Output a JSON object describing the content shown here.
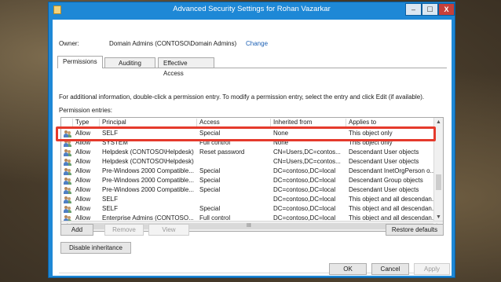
{
  "window": {
    "title": "Advanced Security Settings for Rohan Vazarkar",
    "min": "–",
    "max": "☐",
    "close": "X"
  },
  "owner": {
    "label": "Owner:",
    "value": "Domain Admins (CONTOSO\\Domain Admins)",
    "change_link": "Change"
  },
  "tabs": [
    {
      "label": "Permissions",
      "active": true
    },
    {
      "label": "Auditing"
    },
    {
      "label": "Effective Access"
    }
  ],
  "info_text": "For additional information, double-click a permission entry. To modify a permission entry, select the entry and click Edit (if available).",
  "permission_entries_label": "Permission entries:",
  "columns": [
    "Type",
    "Principal",
    "Access",
    "Inherited from",
    "Applies to"
  ],
  "rows": [
    {
      "type": "Allow",
      "principal": "SELF",
      "access": "Special",
      "inherited": "None",
      "applies": "This object only"
    },
    {
      "type": "Allow",
      "principal": "SYSTEM",
      "access": "Full control",
      "inherited": "None",
      "applies": "This object only"
    },
    {
      "type": "Allow",
      "principal": "Helpdesk (CONTOSO\\Helpdesk)",
      "access": "Reset password",
      "inherited": "CN=Users,DC=contos...",
      "applies": "Descendant User objects"
    },
    {
      "type": "Allow",
      "principal": "Helpdesk (CONTOSO\\Helpdesk)",
      "access": "",
      "inherited": "CN=Users,DC=contos...",
      "applies": "Descendant User objects"
    },
    {
      "type": "Allow",
      "principal": "Pre-Windows 2000 Compatible...",
      "access": "Special",
      "inherited": "DC=contoso,DC=local",
      "applies": "Descendant InetOrgPerson o..."
    },
    {
      "type": "Allow",
      "principal": "Pre-Windows 2000 Compatible...",
      "access": "Special",
      "inherited": "DC=contoso,DC=local",
      "applies": "Descendant Group objects"
    },
    {
      "type": "Allow",
      "principal": "Pre-Windows 2000 Compatible...",
      "access": "Special",
      "inherited": "DC=contoso,DC=local",
      "applies": "Descendant User objects"
    },
    {
      "type": "Allow",
      "principal": "SELF",
      "access": "",
      "inherited": "DC=contoso,DC=local",
      "applies": "This object and all descendan..."
    },
    {
      "type": "Allow",
      "principal": "SELF",
      "access": "Special",
      "inherited": "DC=contoso,DC=local",
      "applies": "This object and all descendan..."
    },
    {
      "type": "Allow",
      "principal": "Enterprise Admins (CONTOSO...",
      "access": "Full control",
      "inherited": "DC=contoso,DC=local",
      "applies": "This object and all descendan..."
    }
  ],
  "scroll": {
    "up": "▲",
    "down": "▼",
    "left": "◀",
    "right": "▶",
    "grip": "III"
  },
  "buttons": {
    "add": "Add",
    "remove": "Remove",
    "view": "View",
    "restore": "Restore defaults",
    "disable_inheritance": "Disable inheritance",
    "ok": "OK",
    "cancel": "Cancel",
    "apply": "Apply"
  },
  "colors": {
    "titlebar": "#1e88d6",
    "highlight": "#e53a2c",
    "link": "#1a5fb4"
  }
}
